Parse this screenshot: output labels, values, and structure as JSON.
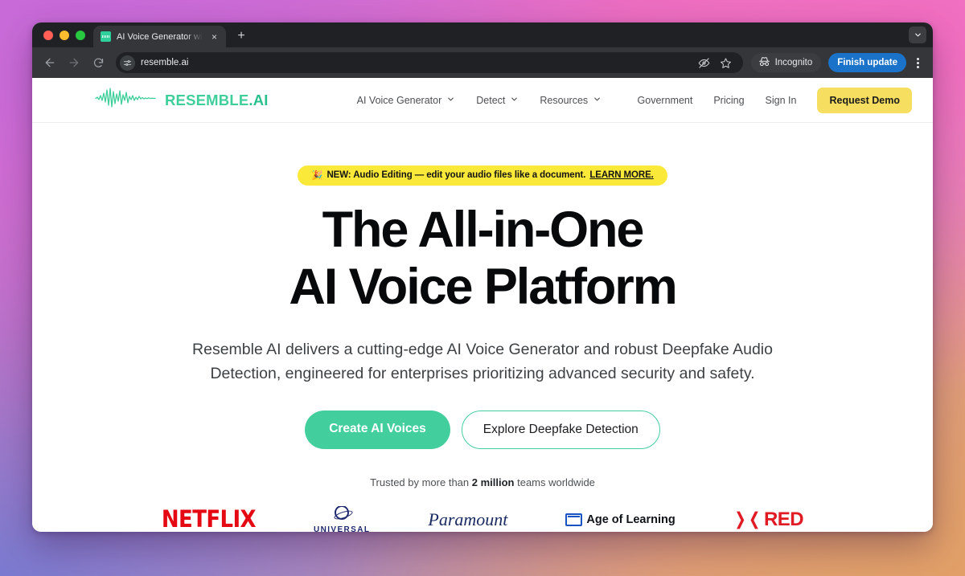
{
  "browser": {
    "tab": {
      "title": "AI Voice Generator with Text t",
      "favicon": "resemble-logo-favicon",
      "close_label": "×",
      "newtab_label": "+"
    },
    "toolbar": {
      "back_icon": "arrow-left-icon",
      "forward_icon": "arrow-right-icon",
      "reload_icon": "reload-icon",
      "site_settings_icon": "tune-sliders-icon",
      "url": "resemble.ai",
      "tracking_icon": "eye-slash-icon",
      "bookmark_icon": "star-icon",
      "incognito_label": "Incognito",
      "incognito_icon": "incognito-hat-icon",
      "update_label": "Finish update",
      "menu_icon": "kebab-menu-icon",
      "tabsearch_icon": "chevron-down-icon"
    }
  },
  "site": {
    "brand": {
      "name": "RESEMBLE",
      "suffix": ".AI",
      "logo_icon": "audio-waveform-icon",
      "accent_color": "#3ecf9a"
    },
    "nav": [
      {
        "label": "AI Voice Generator",
        "has_dropdown": true
      },
      {
        "label": "Detect",
        "has_dropdown": true
      },
      {
        "label": "Resources",
        "has_dropdown": true
      }
    ],
    "right_nav": [
      {
        "label": "Government"
      },
      {
        "label": "Pricing"
      },
      {
        "label": "Sign In"
      }
    ],
    "cta_header": {
      "label": "Request Demo",
      "color": "#f6de60"
    }
  },
  "hero": {
    "announcement": {
      "emoji": "🎉",
      "text": "NEW: Audio Editing — edit your audio files like a document.",
      "link_label": "LEARN MORE.",
      "background": "#fbe93a"
    },
    "title_line_1": "The All-in-One",
    "title_line_2": "AI Voice Platform",
    "subtitle": "Resemble AI delivers a cutting-edge AI Voice Generator and robust Deepfake Audio Detection, engineered for enterprises prioritizing advanced security and safety.",
    "primary_cta": {
      "label": "Create AI Voices",
      "color": "#43cf9d"
    },
    "secondary_cta": {
      "label": "Explore Deepfake Detection",
      "border_color": "#43cf9d"
    },
    "trusted": {
      "prefix": "Trusted by more than ",
      "highlight": "2 million",
      "suffix": " teams worldwide"
    },
    "logos": [
      {
        "name": "NETFLIX",
        "color": "#e50914"
      },
      {
        "name": "UNIVERSAL",
        "color": "#1f2a6e"
      },
      {
        "name": "Paramount",
        "color": "#1b2c63"
      },
      {
        "name": "Age of Learning",
        "color": "#10131a"
      },
      {
        "name": "RED",
        "color": "#e01b24"
      }
    ]
  }
}
